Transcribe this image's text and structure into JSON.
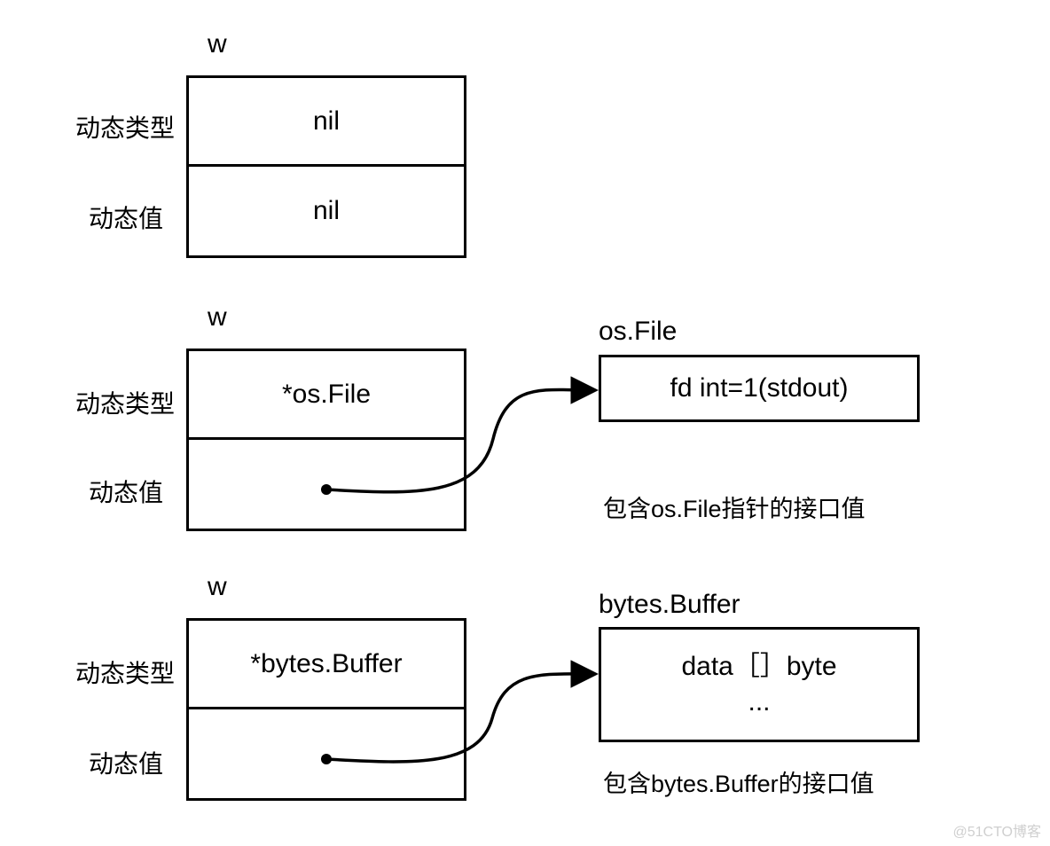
{
  "group1": {
    "title": "w",
    "row1_label": "动态类型",
    "row2_label": "动态值",
    "cell1": "nil",
    "cell2": "nil"
  },
  "group2": {
    "title": "w",
    "row1_label": "动态类型",
    "row2_label": "动态值",
    "cell1": "*os.File",
    "right_title": "os.File",
    "right_content": "fd int=1(stdout)",
    "caption": "包含os.File指针的接口值"
  },
  "group3": {
    "title": "w",
    "row1_label": "动态类型",
    "row2_label": "动态值",
    "cell1": "*bytes.Buffer",
    "right_title": "bytes.Buffer",
    "right_line1": "data［］byte",
    "right_line2": "...",
    "caption": "包含bytes.Buffer的接口值"
  },
  "watermark": "@51CTO博客"
}
